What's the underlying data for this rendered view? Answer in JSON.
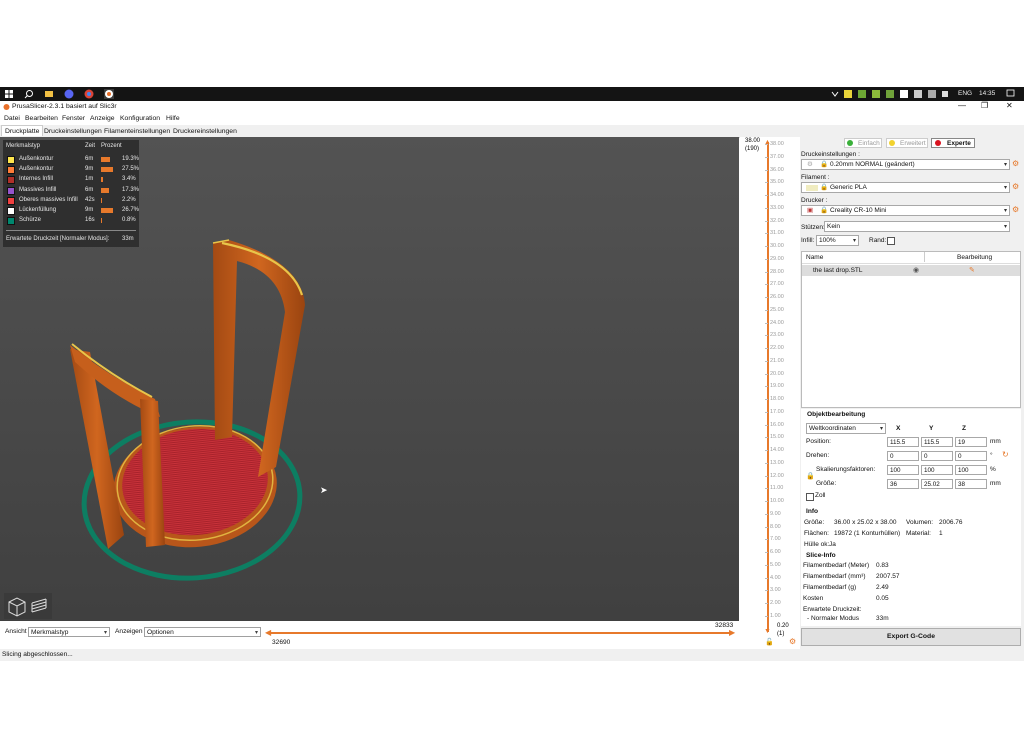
{
  "taskbar": {
    "tray_lang": "ENG",
    "tray_time": "14:35"
  },
  "window": {
    "title": "PrusaSlicer-2.3.1 basiert auf Slic3r"
  },
  "menu": [
    "Datei",
    "Bearbeiten",
    "Fenster",
    "Anzeige",
    "Konfiguration",
    "Hilfe"
  ],
  "tabs": [
    "Druckplatte",
    "Druckeinstellungen",
    "Filamenteinstellungen",
    "Druckereinstellungen"
  ],
  "legend": {
    "headers": {
      "type": "Merkmalstyp",
      "time": "Zeit",
      "pct": "Prozent"
    },
    "rows": [
      {
        "name": "Außenkontur",
        "time": "6m",
        "pct": "19.3%",
        "color": "#ffe64d",
        "fraction": 0.193
      },
      {
        "name": "Außenkontur",
        "time": "9m",
        "pct": "27.5%",
        "color": "#ff7d38",
        "fraction": 0.275
      },
      {
        "name": "Internes Infill",
        "time": "1m",
        "pct": "3.4%",
        "color": "#b03029",
        "fraction": 0.034
      },
      {
        "name": "Massives Infill",
        "time": "6m",
        "pct": "17.3%",
        "color": "#9654cc",
        "fraction": 0.173
      },
      {
        "name": "Oberes massives Infill",
        "time": "42s",
        "pct": "2.2%",
        "color": "#f04040",
        "fraction": 0.022
      },
      {
        "name": "Lückenfüllung",
        "time": "9m",
        "pct": "26.7%",
        "color": "#ffffff",
        "fraction": 0.267
      },
      {
        "name": "Schürze",
        "time": "16s",
        "pct": "0.8%",
        "color": "#00876e",
        "fraction": 0.008
      }
    ],
    "estimate": "Erwartete Druckzeit [Normaler Modus]:",
    "estimate_value": "33m"
  },
  "bottom": {
    "view_label": "Ansicht",
    "view_value": "Merkmalstyp",
    "show_label": "Anzeigen",
    "show_value": "Optionen",
    "hslider_left": "32690",
    "hslider_right": "32833"
  },
  "status": "Slicing abgeschlossen...",
  "vslider": {
    "top_value": "38.00",
    "top_layer": "(190)",
    "bottom_value": "0.20",
    "bottom_layer": "(1)",
    "ticks": [
      "38.00",
      "37.00",
      "36.00",
      "35.00",
      "34.00",
      "33.00",
      "32.00",
      "31.00",
      "30.00",
      "29.00",
      "28.00",
      "27.00",
      "26.00",
      "25.00",
      "24.00",
      "23.00",
      "22.00",
      "21.00",
      "20.00",
      "19.00",
      "18.00",
      "17.00",
      "16.00",
      "15.00",
      "14.00",
      "13.00",
      "12.00",
      "11.00",
      "10.00",
      "9.00",
      "8.00",
      "7.00",
      "6.00",
      "5.00",
      "4.00",
      "3.00",
      "2.00",
      "1.00"
    ]
  },
  "mode": {
    "simple": "Einfach",
    "advanced": "Erweitert",
    "expert": "Experte"
  },
  "settings": {
    "print_label": "Druckeinstellungen :",
    "print_value": "0.20mm NORMAL (geändert)",
    "filament_label": "Filament :",
    "filament_value": "Generic PLA",
    "printer_label": "Drucker :",
    "printer_value": "Creality CR-10 Mini",
    "support_label": "Stützen:",
    "support_value": "Kein",
    "infill_label": "Infill:",
    "infill_value": "100%",
    "brim_label": "Rand:"
  },
  "objects": {
    "col_name": "Name",
    "col_edit": "Bearbeitung",
    "items": [
      {
        "name": "the last drop.STL"
      }
    ]
  },
  "manip": {
    "title": "Objektbearbeitung",
    "coord": "Weltkoordinaten",
    "x": "X",
    "y": "Y",
    "z": "Z",
    "position_label": "Position:",
    "position": [
      "115.5",
      "115.5",
      "19"
    ],
    "position_unit": "mm",
    "rotate_label": "Drehen:",
    "rotate": [
      "0",
      "0",
      "0"
    ],
    "rotate_unit": "°",
    "scale_label": "Skalierungsfaktoren:",
    "scale": [
      "100",
      "100",
      "100"
    ],
    "scale_unit": "%",
    "size_label": "Größe:",
    "size": [
      "36",
      "25.02",
      "38"
    ],
    "size_unit": "mm",
    "inch_label": "Zoll"
  },
  "info": {
    "title": "Info",
    "size_label": "Größe:",
    "size_value": "36.00 x 25.02 x 38.00",
    "volume_label": "Volumen:",
    "volume_value": "2006.76",
    "facets_label": "Flächen:",
    "facets_value": "19872 (1 Konturhüllen)",
    "material_label": "Material:",
    "material_value": "1",
    "hull_label": "Hülle ok:",
    "hull_value": "Ja"
  },
  "slice": {
    "title": "Slice-Info",
    "rows": [
      {
        "label": "Filamentbedarf (Meter)",
        "value": "0.83"
      },
      {
        "label": "Filamentbedarf (mm³)",
        "value": "2007.57"
      },
      {
        "label": "Filamentbedarf (g)",
        "value": "2.49"
      },
      {
        "label": "Kosten",
        "value": "0.05"
      }
    ],
    "est_label": "Erwartete Druckzeit:",
    "mode_label": "- Normaler Modus",
    "mode_value": "33m"
  },
  "export_label": "Export G-Code"
}
